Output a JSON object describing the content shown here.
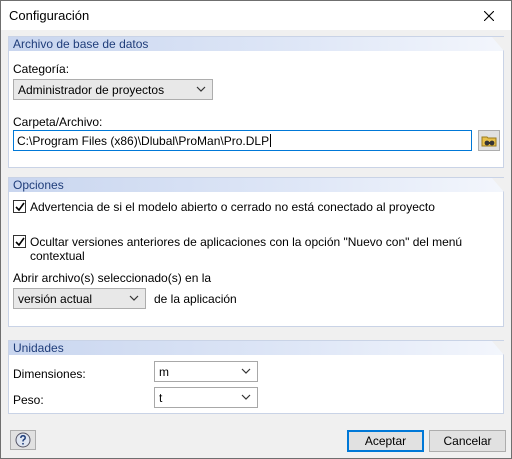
{
  "window": {
    "title": "Configuración"
  },
  "database": {
    "header": "Archivo de base de datos",
    "category_label": "Categoría:",
    "category_value": "Administrador de proyectos",
    "folder_label": "Carpeta/Archivo:",
    "folder_value": "C:\\Program Files (x86)\\Dlubal\\ProMan\\Pro.DLP"
  },
  "options": {
    "header": "Opciones",
    "warning_label": "Advertencia de si el modelo abierto o cerrado no está conectado al proyecto",
    "warning_checked": true,
    "hide_label_line1": "Ocultar versiones anteriores de aplicaciones con la opción \"Nuevo con\" del menú",
    "hide_label_line2": "contextual",
    "hide_checked": true,
    "open_files_label": "Abrir archivo(s) seleccionado(s) en la",
    "version_value": "versión actual",
    "version_suffix": "de la aplicación"
  },
  "units": {
    "header": "Unidades",
    "dimensions_label": "Dimensiones:",
    "dimensions_value": "m",
    "weight_label": "Peso:",
    "weight_value": "t"
  },
  "buttons": {
    "accept": "Aceptar",
    "cancel": "Cancelar"
  },
  "colors": {
    "accent": "#0078d7",
    "group_header_text": "#1f3d7a",
    "group_header_bg": "#c9d6ef"
  }
}
